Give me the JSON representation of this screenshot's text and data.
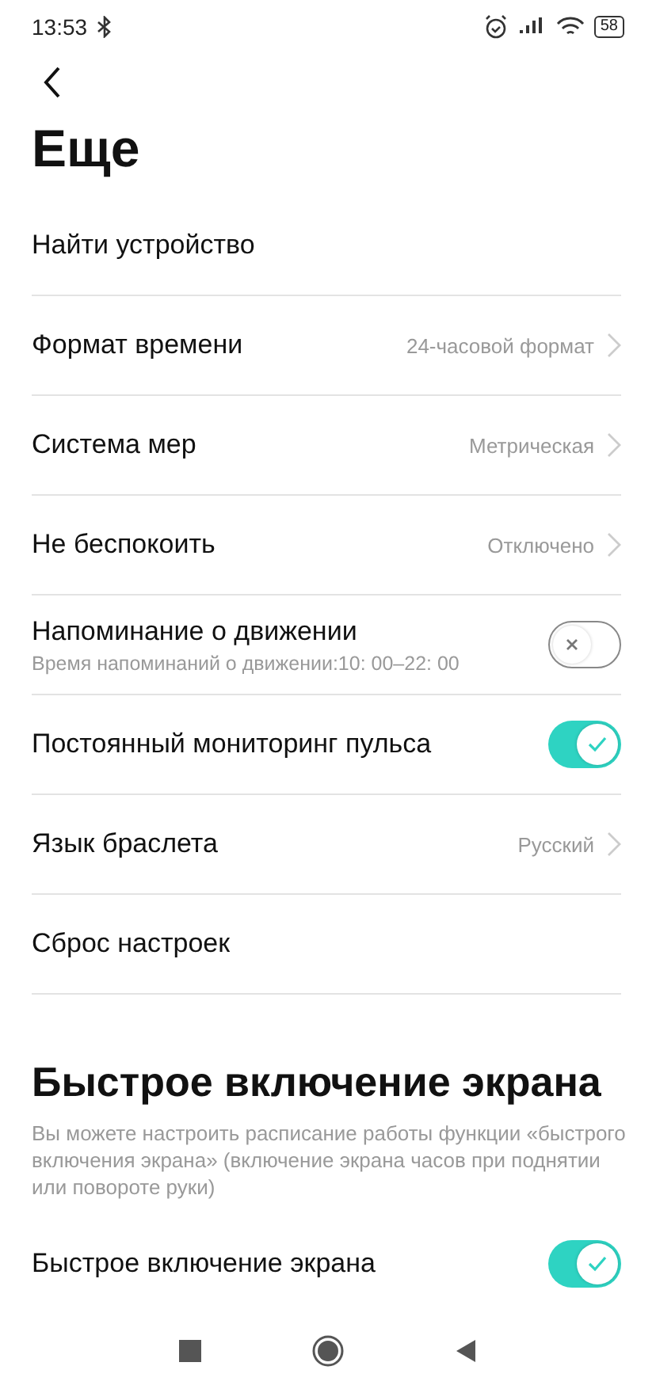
{
  "status_bar": {
    "time": "13:53",
    "battery": "58"
  },
  "title": "Еще",
  "items": [
    {
      "kind": "nav",
      "label": "Найти устройство"
    },
    {
      "kind": "value",
      "label": "Формат времени",
      "value": "24-часовой формат"
    },
    {
      "kind": "value",
      "label": "Система мер",
      "value": "Метрическая"
    },
    {
      "kind": "value",
      "label": "Не беспокоить",
      "value": "Отключено"
    },
    {
      "kind": "toggle",
      "label": "Напоминание о движении",
      "subtitle": "Время напоминаний о движении:10: 00–22: 00",
      "on": false
    },
    {
      "kind": "toggle",
      "label": "Постоянный мониторинг пульса",
      "on": true
    },
    {
      "kind": "value",
      "label": "Язык браслета",
      "value": "Русский"
    },
    {
      "kind": "nav",
      "label": "Сброс настроек"
    }
  ],
  "section": {
    "title": "Быстрое включение экрана",
    "description": "Вы можете настроить расписание работы функции «быстрого включения экрана» (включение экрана часов при поднятии или повороте руки)",
    "items": [
      {
        "kind": "toggle",
        "label": "Быстрое включение экрана",
        "on": true
      }
    ]
  }
}
